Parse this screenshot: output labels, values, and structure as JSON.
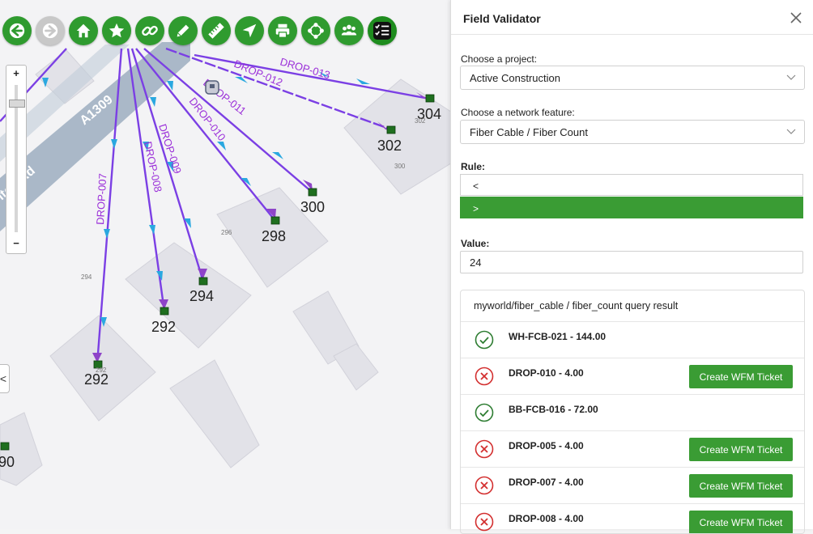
{
  "toolbar": {
    "tools": [
      {
        "icon": "back-arrow-icon",
        "state": "enabled"
      },
      {
        "icon": "forward-arrow-icon",
        "state": "disabled"
      },
      {
        "icon": "home-icon",
        "state": "enabled"
      },
      {
        "icon": "star-icon",
        "state": "enabled"
      },
      {
        "icon": "link-icon",
        "state": "enabled"
      },
      {
        "icon": "pencil-icon",
        "state": "enabled"
      },
      {
        "icon": "ruler-icon",
        "state": "enabled"
      },
      {
        "icon": "navigate-icon",
        "state": "enabled"
      },
      {
        "icon": "print-icon",
        "state": "enabled"
      },
      {
        "icon": "network-icon",
        "state": "enabled"
      },
      {
        "icon": "group-icon",
        "state": "enabled"
      },
      {
        "icon": "checklist-icon",
        "state": "active"
      }
    ]
  },
  "zoom": {
    "in_label": "+",
    "out_label": "−"
  },
  "map": {
    "road_name": "A1309",
    "street_name": "lton Rd",
    "drop_labels": [
      "DROP-013",
      "DROP-012",
      "DROP-011",
      "DROP-010",
      "DROP-009",
      "DROP-008",
      "DROP-007"
    ],
    "address_labels": [
      "304",
      "302",
      "300",
      "298",
      "294",
      "292",
      "292",
      "90"
    ],
    "small_labels": [
      "302",
      "300",
      "296",
      "294",
      "292"
    ],
    "collapse_label": "<"
  },
  "panel": {
    "title": "Field Validator",
    "project_label": "Choose a project:",
    "project_value": "Active Construction",
    "feature_label": "Choose a network feature:",
    "feature_value": "Fiber Cable / Fiber Count",
    "rule_label": "Rule:",
    "rule_options": [
      "<",
      ">"
    ],
    "rule_selected": ">",
    "value_label": "Value:",
    "value": "24",
    "results_title": "myworld/fiber_cable / fiber_count query result",
    "results": [
      {
        "status": "pass",
        "text": "WH-FCB-021 - 144.00"
      },
      {
        "status": "fail",
        "text": "DROP-010 - 4.00",
        "action": "Create WFM Ticket"
      },
      {
        "status": "pass",
        "text": "BB-FCB-016 - 72.00"
      },
      {
        "status": "fail",
        "text": "DROP-005 - 4.00",
        "action": "Create WFM Ticket"
      },
      {
        "status": "fail",
        "text": "DROP-007 - 4.00",
        "action": "Create WFM Ticket"
      },
      {
        "status": "fail",
        "text": "DROP-008 - 4.00",
        "action": "Create WFM Ticket"
      }
    ],
    "colors": {
      "accent": "#3a9c34",
      "pass": "#2e7d32",
      "fail": "#d32f2f",
      "drop_line": "#7b3fe4",
      "drop_label": "#9b30d9"
    }
  }
}
